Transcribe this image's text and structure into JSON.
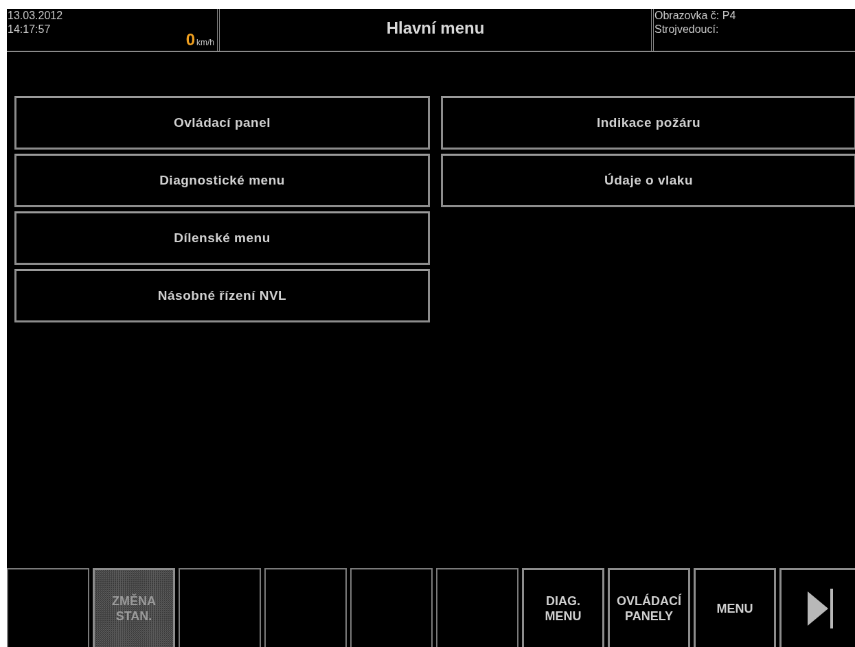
{
  "header": {
    "date": "13.03.2012",
    "time": "14:17:57",
    "speed": "0",
    "speed_unit": "km/h",
    "title": "Hlavní menu",
    "screen_label": "Obrazovka č: P4",
    "driver_label": "Strojvedoucí:"
  },
  "menu_columns": [
    [
      {
        "label": "Ovládací panel"
      },
      {
        "label": "Diagnostické menu"
      },
      {
        "label": "Dílenské menu"
      },
      {
        "label": "Násobné řízení NVL"
      }
    ],
    [
      {
        "label": "Indikace požáru"
      },
      {
        "label": "Údaje o vlaku"
      }
    ]
  ],
  "soft_keys": [
    {
      "kind": "blank"
    },
    {
      "kind": "text",
      "label": "ZMĚNA\nSTAN.",
      "disabled": true
    },
    {
      "kind": "blank"
    },
    {
      "kind": "blank"
    },
    {
      "kind": "blank"
    },
    {
      "kind": "blank"
    },
    {
      "kind": "text",
      "label": "DIAG.\nMENU",
      "disabled": false
    },
    {
      "kind": "text",
      "label": "OVLÁDACÍ\nPANELY",
      "disabled": false
    },
    {
      "kind": "text",
      "label": "MENU",
      "disabled": false
    },
    {
      "kind": "icon"
    }
  ]
}
